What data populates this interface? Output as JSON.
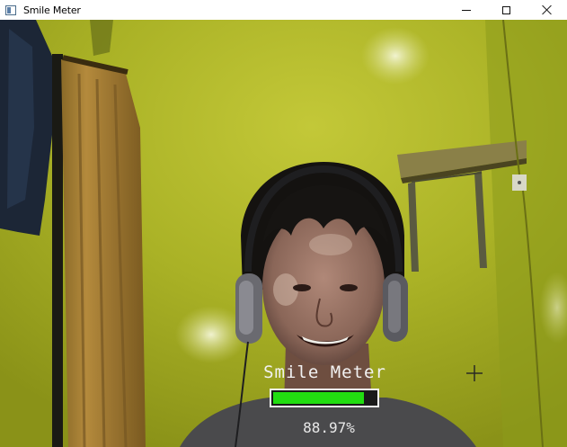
{
  "window": {
    "title": "Smile Meter"
  },
  "overlay": {
    "label": "Smile Meter",
    "percent_text": "88.97%",
    "meter_fraction": 0.8897,
    "meter_color": "#22dd11"
  },
  "icons": [
    "app-icon",
    "minimize-icon",
    "maximize-icon",
    "close-icon"
  ]
}
